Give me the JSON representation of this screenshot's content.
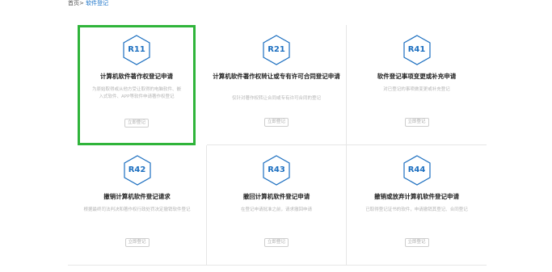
{
  "breadcrumb": {
    "home": "首页",
    "separator": ">",
    "current": "软件登记"
  },
  "colors": {
    "accent": "#1c6fc0",
    "selected_border": "#2fb43a"
  },
  "cards": [
    {
      "code": "R11",
      "title": "计算机软件著作权登记申请",
      "desc": "为原始取得或从他方受让取得的电脑软件、嵌入式软件、APP等软件申请著作权登记",
      "button": "立即登记"
    },
    {
      "code": "R21",
      "title": "计算机软件著作权转让或专有许可合同登记申请",
      "desc": "仅针对著作权转让合同或专有许可合同的登记",
      "button": "立即登记"
    },
    {
      "code": "R41",
      "title": "软件登记事项变更或补充申请",
      "desc": "对已登记的事项做变更或补充登记",
      "button": "立即登记"
    },
    {
      "code": "R42",
      "title": "撤销计算机软件登记请求",
      "desc": "根据最终司法判决和著作权行政处罚决定撤销软件登记",
      "button": "立即登记"
    },
    {
      "code": "R43",
      "title": "撤回计算机软件登记申请",
      "desc": "在登记申请批准之前，请求撤回申请",
      "button": "立即登记"
    },
    {
      "code": "R44",
      "title": "撤销或放弃计算机软件登记申请",
      "desc": "已取得登记证书的软件，申请撤销其登记、合同登记",
      "button": "立即登记"
    }
  ]
}
